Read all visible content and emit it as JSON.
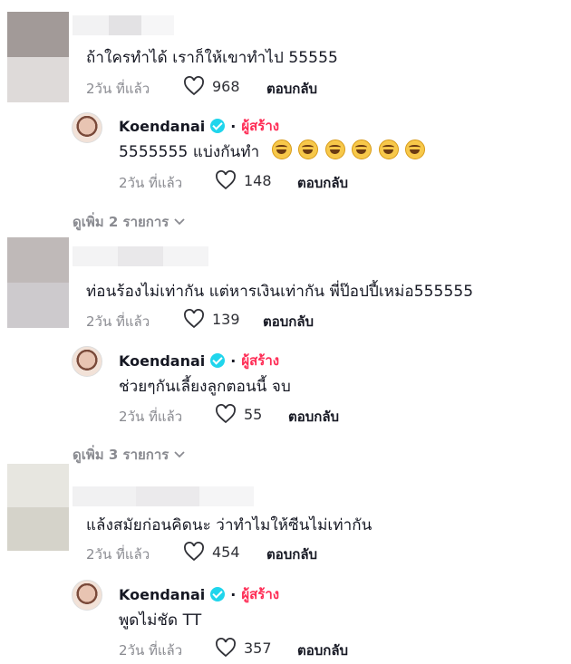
{
  "colors": {
    "creator_badge": "#fe2c55",
    "verified": "#20d5ec",
    "meta": "#8a8b91"
  },
  "comments": [
    {
      "text": "ถ้าใครทำได้ เราก็ให้เขาทำไป 55555",
      "time": "2วัน ที่แล้ว",
      "likes": "968",
      "reply_label": "ตอบกลับ",
      "creator_reply": {
        "name": "Koendanai",
        "badge": "ผู้สร้าง",
        "text": "5555555 แบ่งกันทำ",
        "emoji_count": 6,
        "time": "2วัน ที่แล้ว",
        "likes": "148",
        "reply_label": "ตอบกลับ"
      },
      "view_more": "ดูเพิ่ม 2 รายการ"
    },
    {
      "text": "ท่อนร้องไม่เท่ากัน แต่หารเงินเท่ากัน พี่ป๊อปปี้เหม่อ555555",
      "time": "2วัน ที่แล้ว",
      "likes": "139",
      "reply_label": "ตอบกลับ",
      "creator_reply": {
        "name": "Koendanai",
        "badge": "ผู้สร้าง",
        "text": "ช่วยๆกันเลี้ยงลูกตอนนี้ จบ",
        "time": "2วัน ที่แล้ว",
        "likes": "55",
        "reply_label": "ตอบกลับ"
      },
      "view_more": "ดูเพิ่ม 3 รายการ"
    },
    {
      "text": "แล้งสมัยก่อนคิดนะ ว่าทำไมให้ซีนไม่เท่ากัน",
      "time": "2วัน ที่แล้ว",
      "likes": "454",
      "reply_label": "ตอบกลับ",
      "creator_reply": {
        "name": "Koendanai",
        "badge": "ผู้สร้าง",
        "text": "พูดไม่ชัด TT",
        "time": "2วัน ที่แล้ว",
        "likes": "357",
        "reply_label": "ตอบกลับ"
      }
    }
  ]
}
